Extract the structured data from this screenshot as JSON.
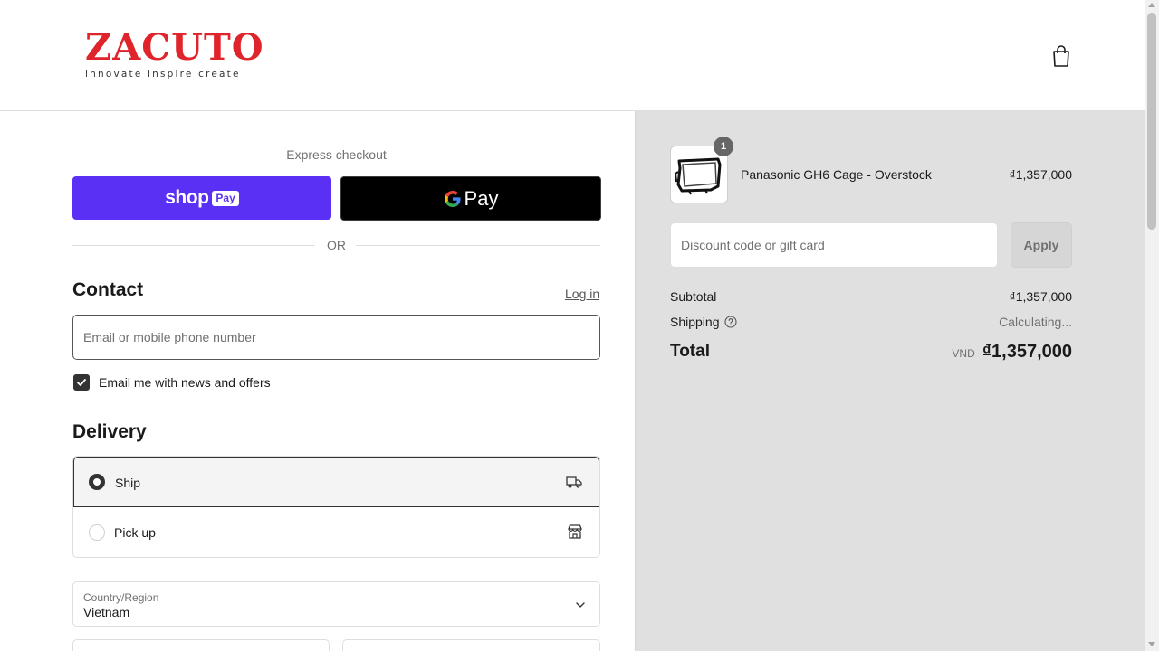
{
  "brand": {
    "name": "ZACUTO",
    "tagline": "innovate inspire create",
    "accent": "#e0242b"
  },
  "header": {
    "cart_icon": "shopping-bag-icon"
  },
  "express": {
    "title": "Express checkout",
    "shop_pay": {
      "word": "shop",
      "badge": "Pay",
      "color": "#5a31f4"
    },
    "google_pay": {
      "word": "Pay"
    },
    "divider": "OR"
  },
  "contact": {
    "title": "Contact",
    "login": "Log in",
    "email_placeholder": "Email or mobile phone number",
    "newsletter": {
      "label": "Email me with news and offers",
      "checked": true
    }
  },
  "delivery": {
    "title": "Delivery",
    "options": [
      {
        "label": "Ship",
        "selected": true,
        "icon": "truck-icon"
      },
      {
        "label": "Pick up",
        "selected": false,
        "icon": "store-icon"
      }
    ],
    "country": {
      "label": "Country/Region",
      "value": "Vietnam"
    }
  },
  "summary": {
    "item": {
      "name": "Panasonic GH6 Cage - Overstock",
      "price": "₫1,357,000",
      "quantity": "1"
    },
    "discount": {
      "placeholder": "Discount code or gift card",
      "button": "Apply"
    },
    "subtotal": {
      "label": "Subtotal",
      "value": "₫1,357,000"
    },
    "shipping": {
      "label": "Shipping",
      "value": "Calculating..."
    },
    "total": {
      "label": "Total",
      "currency": "VND",
      "value": "₫1,357,000"
    }
  }
}
